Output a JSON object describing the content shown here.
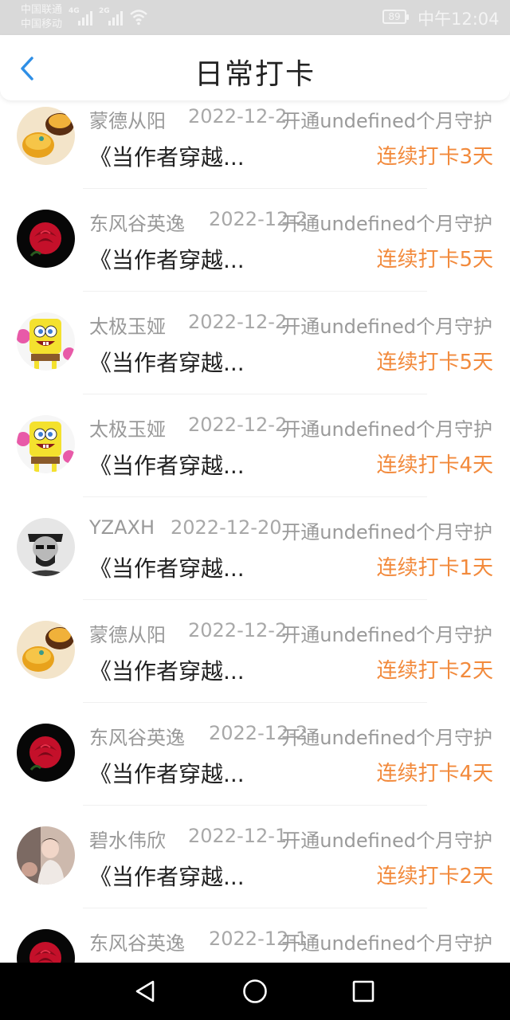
{
  "status_bar": {
    "carrier1": "中国联通",
    "carrier2": "中国移动",
    "net1": "4G",
    "net2": "2G",
    "battery": "89",
    "time": "中午12:04"
  },
  "header": {
    "title": "日常打卡"
  },
  "records": [
    {
      "name": "蒙德从阳",
      "date": "2022-12-2",
      "guard": "开通undefined个月守护",
      "book": "《当作者穿越...",
      "streak": "连续打卡3天",
      "avatar": "cake-avatar"
    },
    {
      "name": "东风谷英逸",
      "date": "2022-12-2",
      "guard": "开通undefined个月守护",
      "book": "《当作者穿越...",
      "streak": "连续打卡5天",
      "avatar": "rose-avatar"
    },
    {
      "name": "太极玉娅",
      "date": "2022-12-2",
      "guard": "开通undefined个月守护",
      "book": "《当作者穿越...",
      "streak": "连续打卡5天",
      "avatar": "spongebob-avatar"
    },
    {
      "name": "太极玉娅",
      "date": "2022-12-2",
      "guard": "开通undefined个月守护",
      "book": "《当作者穿越...",
      "streak": "连续打卡4天",
      "avatar": "spongebob-avatar"
    },
    {
      "name": "YZAXH",
      "date": "2022-12-20",
      "guard": "开通undefined个月守护",
      "book": "《当作者穿越...",
      "streak": "连续打卡1天",
      "avatar": "person-avatar"
    },
    {
      "name": "蒙德从阳",
      "date": "2022-12-2",
      "guard": "开通undefined个月守护",
      "book": "《当作者穿越...",
      "streak": "连续打卡2天",
      "avatar": "cake-avatar"
    },
    {
      "name": "东风谷英逸",
      "date": "2022-12-2",
      "guard": "开通undefined个月守护",
      "book": "《当作者穿越...",
      "streak": "连续打卡4天",
      "avatar": "rose-avatar"
    },
    {
      "name": "碧水伟欣",
      "date": "2022-12-1",
      "guard": "开通undefined个月守护",
      "book": "《当作者穿越...",
      "streak": "连续打卡2天",
      "avatar": "photo-avatar"
    },
    {
      "name": "东风谷英逸",
      "date": "2022-12-1",
      "guard": "开通undefined个月守护",
      "book": "",
      "streak": "",
      "avatar": "rose-avatar"
    }
  ],
  "colors": {
    "accent": "#f28a3c",
    "back_arrow": "#2f8fe6",
    "muted": "#999999"
  },
  "navbar": {
    "back": "back-triangle-icon",
    "home": "home-circle-icon",
    "recents": "recents-square-icon"
  }
}
